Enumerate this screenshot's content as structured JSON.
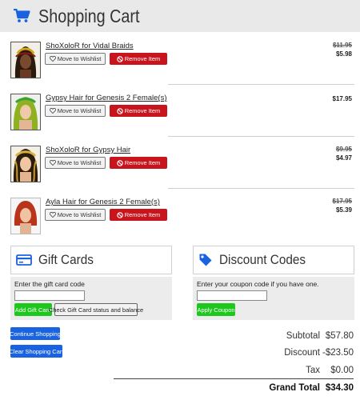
{
  "header": {
    "title": "Shopping Cart"
  },
  "items": [
    {
      "name": "ShoXoloR for Vidal Braids",
      "original_price": "$11.95",
      "price": "$5.98",
      "wishlist_label": "Move to Wishlist",
      "remove_label": "Remove Item"
    },
    {
      "name": "Gypsy Hair for Genesis 2 Female(s)",
      "original_price": "",
      "price": "$17.95",
      "wishlist_label": "Move to Wishlist",
      "remove_label": "Remove Item"
    },
    {
      "name": "ShoXoloR for Gypsy Hair",
      "original_price": "$9.95",
      "price": "$4.97",
      "wishlist_label": "Move to Wishlist",
      "remove_label": "Remove Item"
    },
    {
      "name": "Ayla Hair for Genesis 2 Female(s)",
      "original_price": "$17.95",
      "price": "$5.39",
      "wishlist_label": "Move to Wishlist",
      "remove_label": "Remove Item"
    }
  ],
  "gift_cards": {
    "title": "Gift Cards",
    "prompt": "Enter the gift card code",
    "input_value": "",
    "add_label": "Add Gift Card",
    "check_label": "Check Gift Card status and balance"
  },
  "discount_codes": {
    "title": "Discount Codes",
    "prompt": "Enter your coupon code if you have one.",
    "input_value": "",
    "apply_label": "Apply Coupon"
  },
  "actions": {
    "continue_label": "Continue Shopping",
    "clear_label": "Clear Shopping Cart"
  },
  "summary": {
    "subtotal_label": "Subtotal",
    "subtotal_value": "$57.80",
    "discount_label": "Discount",
    "discount_value": "-$23.50",
    "tax_label": "Tax",
    "tax_value": "$0.00",
    "grand_label": "Grand Total",
    "grand_value": "$34.30"
  },
  "colors": {
    "accent_blue": "#1a63e0",
    "remove_red": "#c8141c",
    "success_green": "#1ec71e",
    "header_bg": "#e9e9e9"
  },
  "icons": [
    "cart-icon",
    "heart-icon",
    "ban-icon",
    "credit-card-icon",
    "tag-icon"
  ]
}
